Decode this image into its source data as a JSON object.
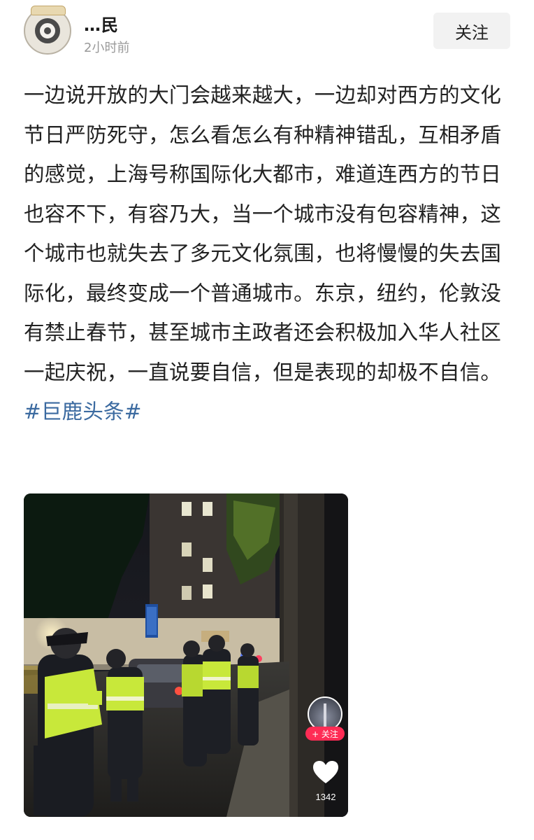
{
  "author": {
    "avatar_icon": "avatar-icon",
    "name": "…民",
    "time": "2小时前"
  },
  "follow_button": "关注",
  "post": {
    "text": "一边说开放的大门会越来越大，一边却对西方的文化节日严防死守，怎么看怎么有种精神错乱，互相矛盾的感觉，上海号称国际化大都市，难道连西方的节日也容不下，有容乃大，当一个城市没有包容精神，这个城市也就失去了多元文化氛围，也将慢慢的失去国际化，最终变成一个普通城市。东京，纽约，伦敦没有禁止春节，甚至城市主政者还会积极加入华人社区一起庆祝，一直说要自信，但是表现的却极不自信。",
    "hashtag": "#巨鹿头条#",
    "hashtag_color": "#3b6aa0"
  },
  "media": {
    "type": "photo",
    "side_follow": "+ 关注",
    "like_icon": "heart-icon",
    "like_count": "1342"
  }
}
